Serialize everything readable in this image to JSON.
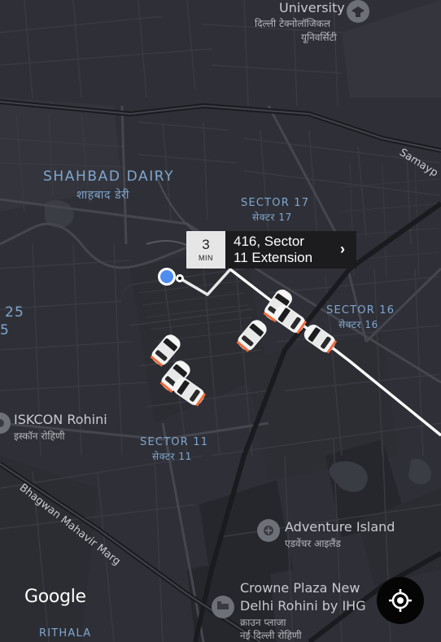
{
  "labels": {
    "university_en": "University",
    "university_hi_1": "दिल्ली टेक्नोलॉजिकल",
    "university_hi_2": "यूनिवर्सिटी",
    "samaypur": "Samayp",
    "shahbad_en": "SHAHBAD DAIRY",
    "shahbad_hi": "शाहबाद डेरी",
    "sector17_en": "SECTOR 17",
    "sector17_hi": "सेक्टर 17",
    "sector16_en": "SECTOR 16",
    "sector16_hi": "सेक्टर 16",
    "sector11_en": "SECTOR 11",
    "sector11_hi": "सेक्टर 11",
    "edge_num_1": "25",
    "edge_num_2": "5",
    "iskcon_en": "ISKCON Rohini",
    "iskcon_hi": "इस्कॉन रोहिणी",
    "bhagwan_road": "Bhagwan Mahavir Marg",
    "adventure_en": "Adventure Island",
    "adventure_hi": "एडवेंचर आइलैंड",
    "crowne_en_1": "Crowne Plaza New",
    "crowne_en_2": "Delhi Rohini by IHG",
    "crowne_hi_1": "क्राउन प्लाजा",
    "crowne_hi_2": "नई दिल्ली रोहिणी",
    "rithala": "RITHALA"
  },
  "eta": {
    "minutes": "3",
    "unit": "MIN",
    "dest_line1": "416, Sector",
    "dest_line2": "11 Extension",
    "chevron": "›"
  },
  "logo": "Google",
  "icons": {
    "locate": "crosshair-target-icon",
    "car": "car-icon",
    "poi": "place-pin-icon",
    "user": "current-location-dot-icon"
  },
  "colors": {
    "map_bg": "#2f3037",
    "area_label": "#7fa6cf",
    "route": "#ffffff",
    "car_tail": "#ef6a3a"
  },
  "cars_visible": 7
}
